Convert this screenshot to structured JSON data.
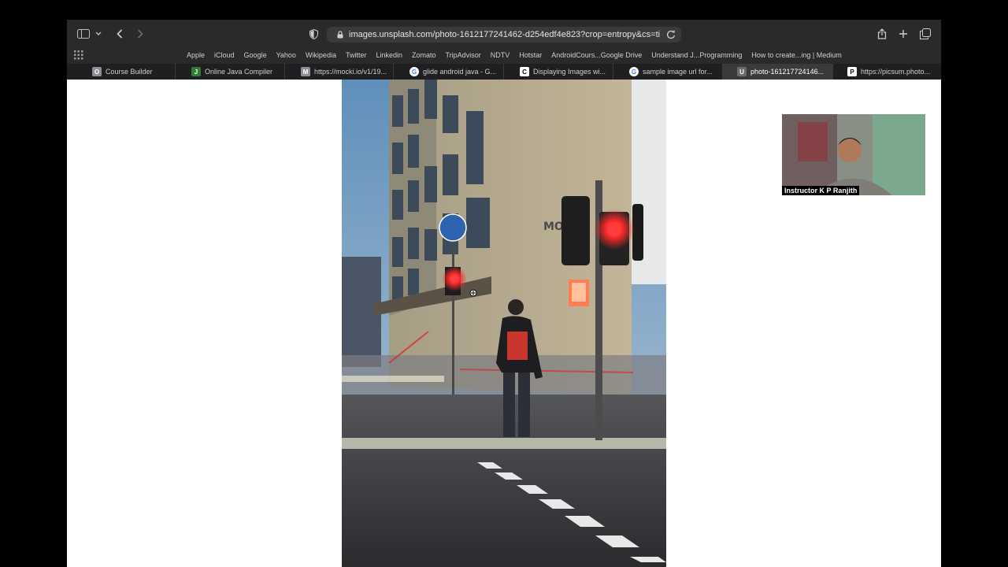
{
  "browser": {
    "url": "images.unsplash.com/photo-1612177241462-d254edf4e823?crop=entropy&cs=tinysrgb",
    "favorites": [
      "Apple",
      "iCloud",
      "Google",
      "Yahoo",
      "Wikipedia",
      "Twitter",
      "Linkedin",
      "Zomato",
      "TripAdvisor",
      "NDTV",
      "Hotstar",
      "AndroidCours...Google Drive",
      "Understand J...Programming",
      "How to create...ing | Medium"
    ],
    "tabs": [
      {
        "label": "Course Builder",
        "favicon": "O"
      },
      {
        "label": "Online Java Compiler",
        "favicon": "J"
      },
      {
        "label": "https://mocki.io/v1/19...",
        "favicon": "M"
      },
      {
        "label": "glide android java - G...",
        "favicon": "G"
      },
      {
        "label": "Displaying Images wi...",
        "favicon": "C"
      },
      {
        "label": "sample image url for...",
        "favicon": "G"
      },
      {
        "label": "photo-161217724146...",
        "favicon": "U"
      },
      {
        "label": "https://picsum.photo...",
        "favicon": "P"
      }
    ]
  },
  "photo": {
    "sign_text": "MO"
  },
  "webcam": {
    "label": "Instructor  K P Ranjith"
  },
  "colors": {
    "toolbar": "#2a2a2c",
    "tabbar": "#1f1f21",
    "active_tab": "#3a3a3c",
    "signal_red": "#ff2a2a"
  }
}
